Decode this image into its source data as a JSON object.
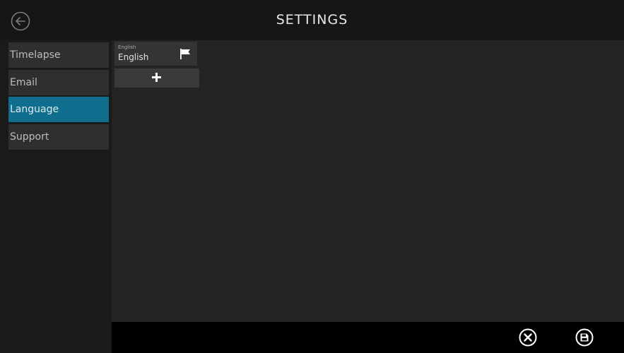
{
  "header": {
    "title": "SETTINGS",
    "back_icon": "arrow-left-circle-icon"
  },
  "sidebar": {
    "items": [
      {
        "label": "Timelapse",
        "active": false
      },
      {
        "label": "Email",
        "active": false
      },
      {
        "label": "Language",
        "active": true
      },
      {
        "label": "Support",
        "active": false
      }
    ]
  },
  "content": {
    "language_card": {
      "small_label": "English",
      "label": "English",
      "icon": "flag-icon"
    },
    "add_button_icon": "plus-icon"
  },
  "footer": {
    "cancel_icon": "close-circle-icon",
    "save_icon": "save-disk-icon"
  },
  "colors": {
    "accent": "#0f6d8d",
    "background": "#232323",
    "sidebar_item": "#2f2f2f",
    "footer": "#000000"
  }
}
